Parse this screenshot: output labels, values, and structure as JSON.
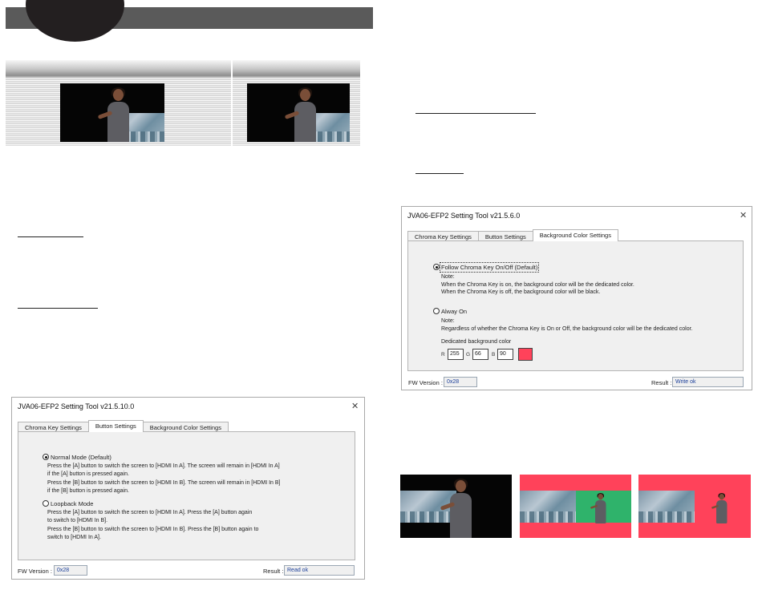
{
  "colors": {
    "header_bar": "#5a5a5a",
    "header_disc": "#231f20",
    "dedicated_background": "#ff425a",
    "chroma_green": "#2fb36b",
    "field_text": "#1b3f9a"
  },
  "button_settings_window": {
    "title": "JVA06-EFP2 Setting Tool v21.5.10.0",
    "close_icon": "close-icon",
    "tabs": [
      {
        "label": "Chroma Key Settings",
        "active": false
      },
      {
        "label": "Button Settings",
        "active": true
      },
      {
        "label": "Background Color Settings",
        "active": false
      }
    ],
    "normal_mode": {
      "label": "Normal Mode (Default)",
      "selected": true,
      "line1": "Press the [A] button to switch the screen to [HDMI In A]. The screen will remain in [HDMI In A]",
      "line2": "if the [A] button is pressed again.",
      "line3": "Press the [B] button to switch the screen to [HDMI In B]. The screen will remain in [HDMI In  B]",
      "line4": "if the [B] button is pressed again."
    },
    "loopback_mode": {
      "label": "Loopback Mode",
      "selected": false,
      "line1": "Press the [A] button to switch the screen to [HDMI In A]. Press the [A] button again",
      "line2": "to switch to [HDMI In B].",
      "line3": "Press the [B] button to switch the screen to [HDMI In B]. Press the  [B] button again to",
      "line4": "switch to [HDMI In A]."
    },
    "fw_label": "FW Version :",
    "fw_value": "0x28",
    "result_label": "Result :",
    "result_value": "Read ok"
  },
  "background_settings_window": {
    "title": "JVA06-EFP2 Setting Tool v21.5.6.0",
    "close_icon": "close-icon",
    "tabs": [
      {
        "label": "Chroma Key Settings",
        "active": false
      },
      {
        "label": "Button Settings",
        "active": false
      },
      {
        "label": "Background Color Settings",
        "active": true
      }
    ],
    "follow_option": {
      "label": "Follow Chroma Key On/Off (Default)",
      "selected": true,
      "note_title": "Note:",
      "note_line1": "When the Chroma Key is on, the background color will be the dedicated color.",
      "note_line2": "When the Chroma Key is off, the background color will be black."
    },
    "always_option": {
      "label": "Alway On",
      "selected": false,
      "note_title": "Note:",
      "note_line1": "Regardless of whether the Chroma Key is On or Off, the background color will be the dedicated color."
    },
    "dedicated_label": "Dedicated background color",
    "r_label": "R",
    "r_value": "255",
    "g_label": "G",
    "g_value": "66",
    "b_label": "B",
    "b_value": "90",
    "fw_label": "FW Version :",
    "fw_value": "0x28",
    "result_label": "Result :",
    "result_value": "Write ok"
  }
}
